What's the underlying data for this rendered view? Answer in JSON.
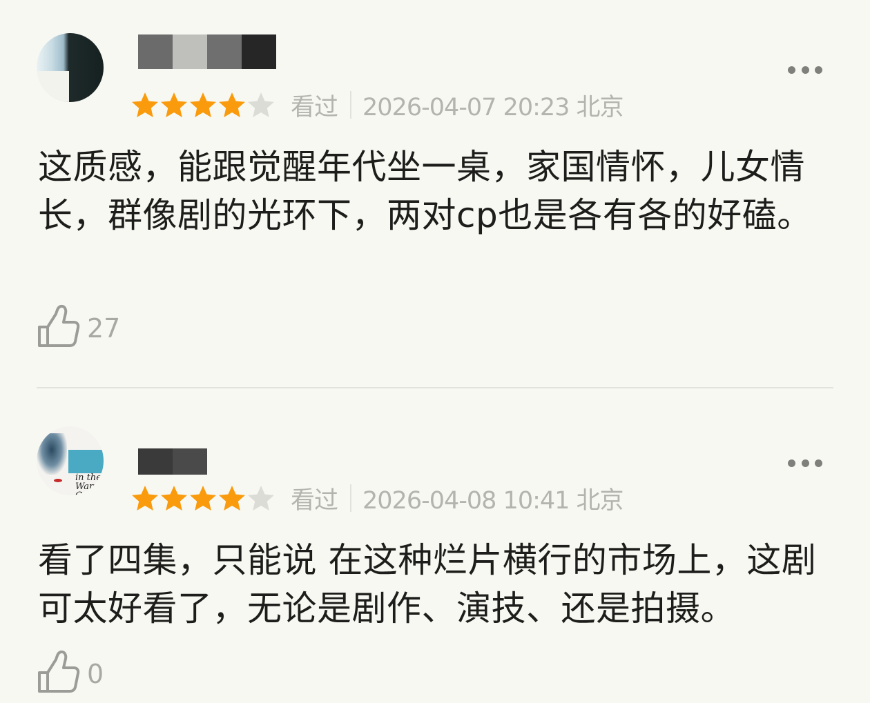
{
  "reviews": [
    {
      "rating": 4,
      "status": "看过",
      "datetime": "2026-04-07 20:23 北京",
      "content": "这质感，能跟觉醒年代坐一桌，家国情怀，儿女情长，群像剧的光环下，两对cp也是各有各的好磕。",
      "likes": "27",
      "username_blocks": [
        "#6b6b6b",
        "#bfbfbb",
        "#6f6f6f",
        "#262626"
      ]
    },
    {
      "rating": 4,
      "status": "看过",
      "datetime": "2026-04-08 10:41 北京",
      "content": "看了四集，只能说 在这种烂片横行的市场上，这剧可太好看了，无论是剧作、演技、还是拍摄。",
      "likes": "0",
      "avatar_text": "in the Warmest Col",
      "username_blocks": [
        "#3a3a3a",
        "#4a4a4a"
      ]
    }
  ],
  "colors": {
    "star_filled": "#f99b0c",
    "star_empty": "#dcdcd7",
    "background": "#f8f8f3"
  }
}
